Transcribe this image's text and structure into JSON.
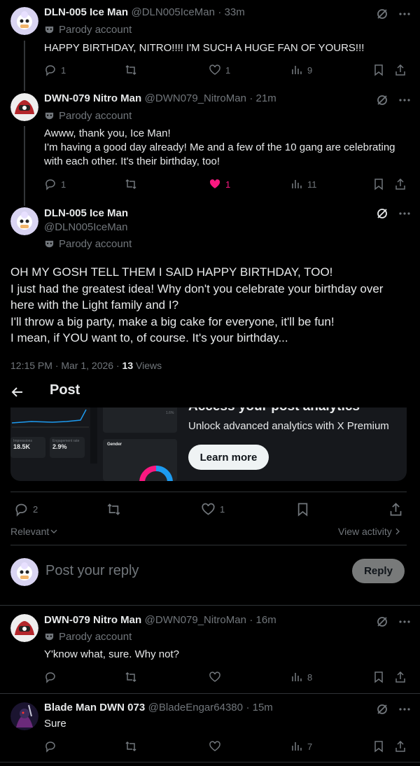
{
  "posts": [
    {
      "name": "DLN-005 Ice Man",
      "handle": "@DLN005IceMan",
      "time": "· 33m",
      "label": "Parody account",
      "lines": [
        "HAPPY BIRTHDAY, NITRO!!!! I'M SUCH A HUGE FAN OF YOURS!!!"
      ],
      "replies": "1",
      "reposts": "",
      "likes": "1",
      "views": "9"
    },
    {
      "name": "DWN-079 Nitro Man",
      "handle": "@DWN079_NitroMan",
      "time": "· 21m",
      "label": "Parody account",
      "lines": [
        "Awww, thank you, Ice Man!",
        "I'm having a good day already! Me and a few of the 10 gang are celebrating",
        "with each other. It's their birthday, too!"
      ],
      "replies": "1",
      "reposts": "",
      "likes": "1",
      "views": "11"
    }
  ],
  "main_post": {
    "name": "DLN-005 Ice Man",
    "handle": "@DLN005IceMan",
    "label": "Parody account",
    "lines": [
      "OH MY GOSH TELL THEM I SAID HAPPY BIRTHDAY, TOO!",
      "I just had the greatest idea! Why don't you celebrate your birthday over",
      "here with the Light family and I?",
      "I'll throw a big party, make a big cake for everyone, it'll be fun!",
      "I mean, if YOU want to, of course. It's your birthday..."
    ],
    "timestamp": "12:15 PM · Mar 1, 2026 · ",
    "views_count": "13",
    "views_label": " Views",
    "replies": "2",
    "likes": "1"
  },
  "header": {
    "title": "Post"
  },
  "promo": {
    "heading": "Access your post analytics",
    "subtitle": "Unlock advanced analytics with X Premium",
    "button": "Learn more",
    "mini_stat_a_label": "Impressions",
    "mini_stat_a": "18.5K",
    "mini_stat_b_label": "Engagement rate",
    "mini_stat_b": "2.9%",
    "mini_gender": "Gender",
    "mini_pct": "1.6%"
  },
  "sort": {
    "label": "Relevant",
    "view_activity": "View activity"
  },
  "reply_box": {
    "placeholder": "Post your reply",
    "button": "Reply"
  },
  "replies": [
    {
      "name": "DWN-079 Nitro Man",
      "handle": "@DWN079_NitroMan",
      "time": "· 16m",
      "label": "Parody account",
      "text": "Y'know what, sure. Why not?",
      "views": "8"
    },
    {
      "name": "Blade Man DWN 073",
      "handle": "@BladeEngar64380",
      "time": "· 15m",
      "text": "Sure",
      "views": "7"
    }
  ],
  "colors": {
    "accent": "#1d9bf0",
    "like_active": "#f91880",
    "muted": "#71767b",
    "border": "#2f3336"
  },
  "icons": [
    "grok-icon",
    "more-icon",
    "reply-icon",
    "repost-icon",
    "like-icon",
    "views-icon",
    "bookmark-icon",
    "share-icon",
    "mask-icon",
    "back-arrow-icon"
  ]
}
